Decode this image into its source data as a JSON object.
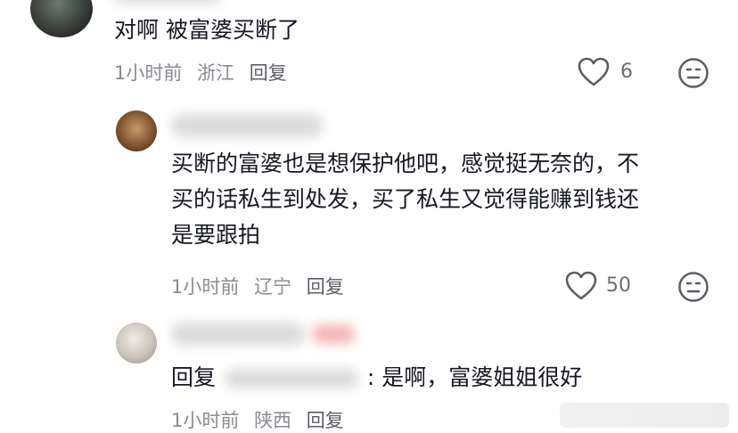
{
  "comments": [
    {
      "text": "对啊 被富婆买断了",
      "meta": {
        "time": "1小时前",
        "region": "浙江",
        "reply": "回复"
      },
      "likes": "6"
    }
  ],
  "replies": [
    {
      "lines": [
        "买断的富婆也是想保护他吧，感觉挺无奈的，不",
        "买的话私生到处发，买了私生又觉得能赚到钱还",
        "是要跟拍"
      ],
      "meta": {
        "time": "1小时前",
        "region": "辽宁",
        "reply": "回复"
      },
      "likes": "50"
    },
    {
      "prefix": "回复",
      "body": ": 是啊，富婆姐姐很好",
      "meta": {
        "time": "1小时前",
        "region": "陕西",
        "reply": "回复"
      }
    }
  ],
  "colors": {
    "text": "#161823",
    "meta": "#8a8b91",
    "icon": "#5c5e66"
  },
  "icons": [
    "heart-icon",
    "meh-face-icon"
  ]
}
